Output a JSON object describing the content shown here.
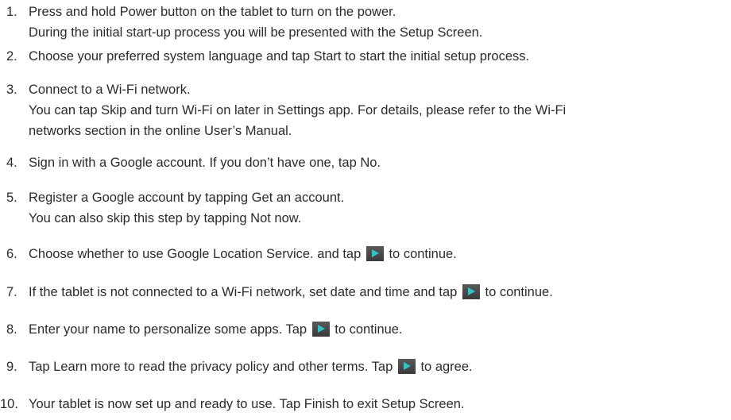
{
  "steps": [
    {
      "number": "1.",
      "lines": [
        "Press and hold Power button on the tablet to turn on the power.",
        "During the initial start-up process you will be presented with the Setup Screen."
      ]
    },
    {
      "number": "2.",
      "lines": [
        "Choose your preferred system language and tap Start to start the initial setup process."
      ]
    },
    {
      "number": "3.",
      "lines": [
        "Connect to a Wi-Fi network.",
        "You can tap Skip and turn Wi-Fi on later in Settings app. For details, please refer to the Wi-Fi",
        "networks section in the online User’s Manual."
      ]
    },
    {
      "number": "4.",
      "lines": [
        "Sign in with a Google account. If you don’t have one, tap No."
      ]
    },
    {
      "number": "5.",
      "lines": [
        "Register a Google account by tapping Get an account.",
        "You can also skip this step by tapping Not now."
      ]
    },
    {
      "number": "6.",
      "before": "Choose whether to use Google Location Service. and tap",
      "after": "to continue."
    },
    {
      "number": "7.",
      "before": "If the tablet is not connected to a Wi-Fi network, set date and time and tap",
      "after": "to continue."
    },
    {
      "number": "8.",
      "before": "Enter your name to personalize some apps. Tap",
      "after": "to continue."
    },
    {
      "number": "9.",
      "before": "Tap Learn more to read the privacy policy and other terms. Tap",
      "after": "to agree."
    },
    {
      "number": "10.",
      "lines": [
        "Your tablet is now set up and ready to use. Tap Finish to exit Setup Screen."
      ]
    }
  ],
  "icons": {
    "next": "play-icon"
  }
}
